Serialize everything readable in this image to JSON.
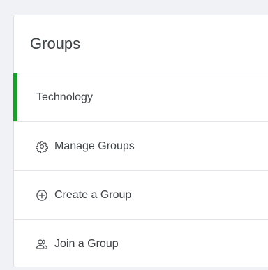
{
  "panel": {
    "title": "Groups",
    "accent_color": "#1a9f29",
    "items": [
      {
        "label": "Technology",
        "icon": null,
        "active": true
      },
      {
        "label": "Manage Groups",
        "icon": "gear-icon",
        "active": false
      },
      {
        "label": "Create a Group",
        "icon": "plus-circle-icon",
        "active": false
      },
      {
        "label": "Join a Group",
        "icon": "users-icon",
        "active": false
      }
    ]
  }
}
